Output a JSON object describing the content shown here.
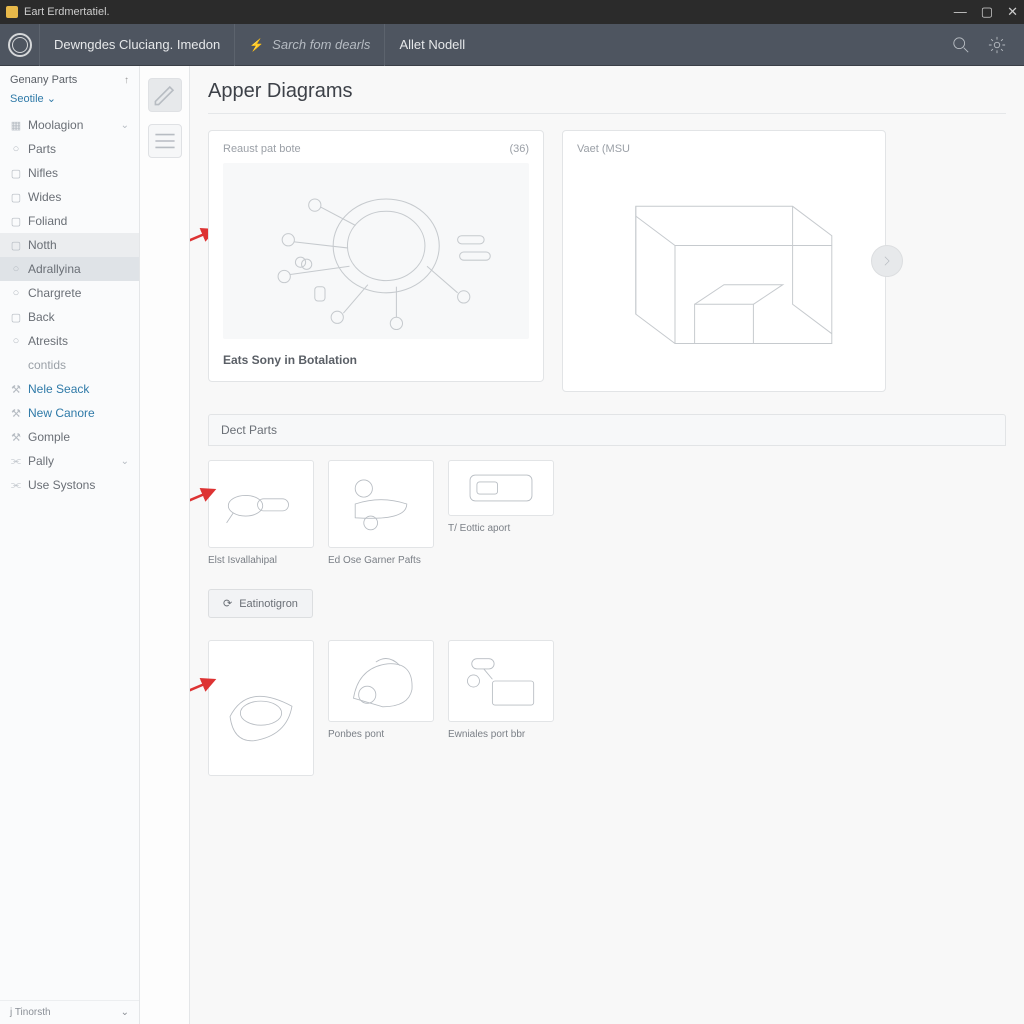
{
  "titlebar": {
    "title": "Eart Erdmertatiel."
  },
  "header": {
    "breadcrumb": "Dewngdes Cluciang. Imedon",
    "search_placeholder": "Sarch fom dearls",
    "model_label": "Allet Nodell"
  },
  "sidebar": {
    "top_label": "Genany Parts",
    "settle_link": "Seotile ⌄",
    "items": [
      {
        "label": "Moolagion",
        "icon": "grid",
        "chevron": true
      },
      {
        "label": "Parts",
        "icon": "circle"
      },
      {
        "label": "Nifles",
        "icon": "square"
      },
      {
        "label": "Wides",
        "icon": "square"
      },
      {
        "label": "Foliand",
        "icon": "square"
      },
      {
        "label": "Notth",
        "icon": "square",
        "active": true
      },
      {
        "label": "Adrallyina",
        "icon": "circle",
        "highlight": true
      },
      {
        "label": "Chargrete",
        "icon": "circle"
      },
      {
        "label": "Back",
        "icon": "square"
      },
      {
        "label": "Atresits",
        "icon": "circle"
      },
      {
        "label": "contids",
        "icon": "",
        "sub": true
      },
      {
        "label": "Nele Seack",
        "icon": "wrench",
        "link": true
      },
      {
        "label": "New Canore",
        "icon": "wrench",
        "link": true
      },
      {
        "label": "Gomple",
        "icon": "wrench"
      },
      {
        "label": "Pally",
        "icon": "link",
        "chevron": true
      },
      {
        "label": "Use Systons",
        "icon": "link"
      }
    ],
    "footer": "j Tinorsth"
  },
  "main": {
    "title": "Apper Diagrams",
    "big_left": {
      "head_left": "Reaust pat bote",
      "head_right": "(36)",
      "caption": "Eats Sony in Botalation"
    },
    "big_right": {
      "head_left": "Vaet (MSU"
    },
    "section_title": "Dect Parts",
    "parts_row1": [
      {
        "label": "Elst Isvallahipal"
      },
      {
        "label": "Ed Ose Garner Pafts"
      },
      {
        "label": "T/ Eottic aport"
      }
    ],
    "action_button": "Eatinotigron",
    "parts_row2": [
      {
        "label": ""
      },
      {
        "label": "Ponbes pont"
      },
      {
        "label": "Ewniales port bbr"
      }
    ]
  }
}
